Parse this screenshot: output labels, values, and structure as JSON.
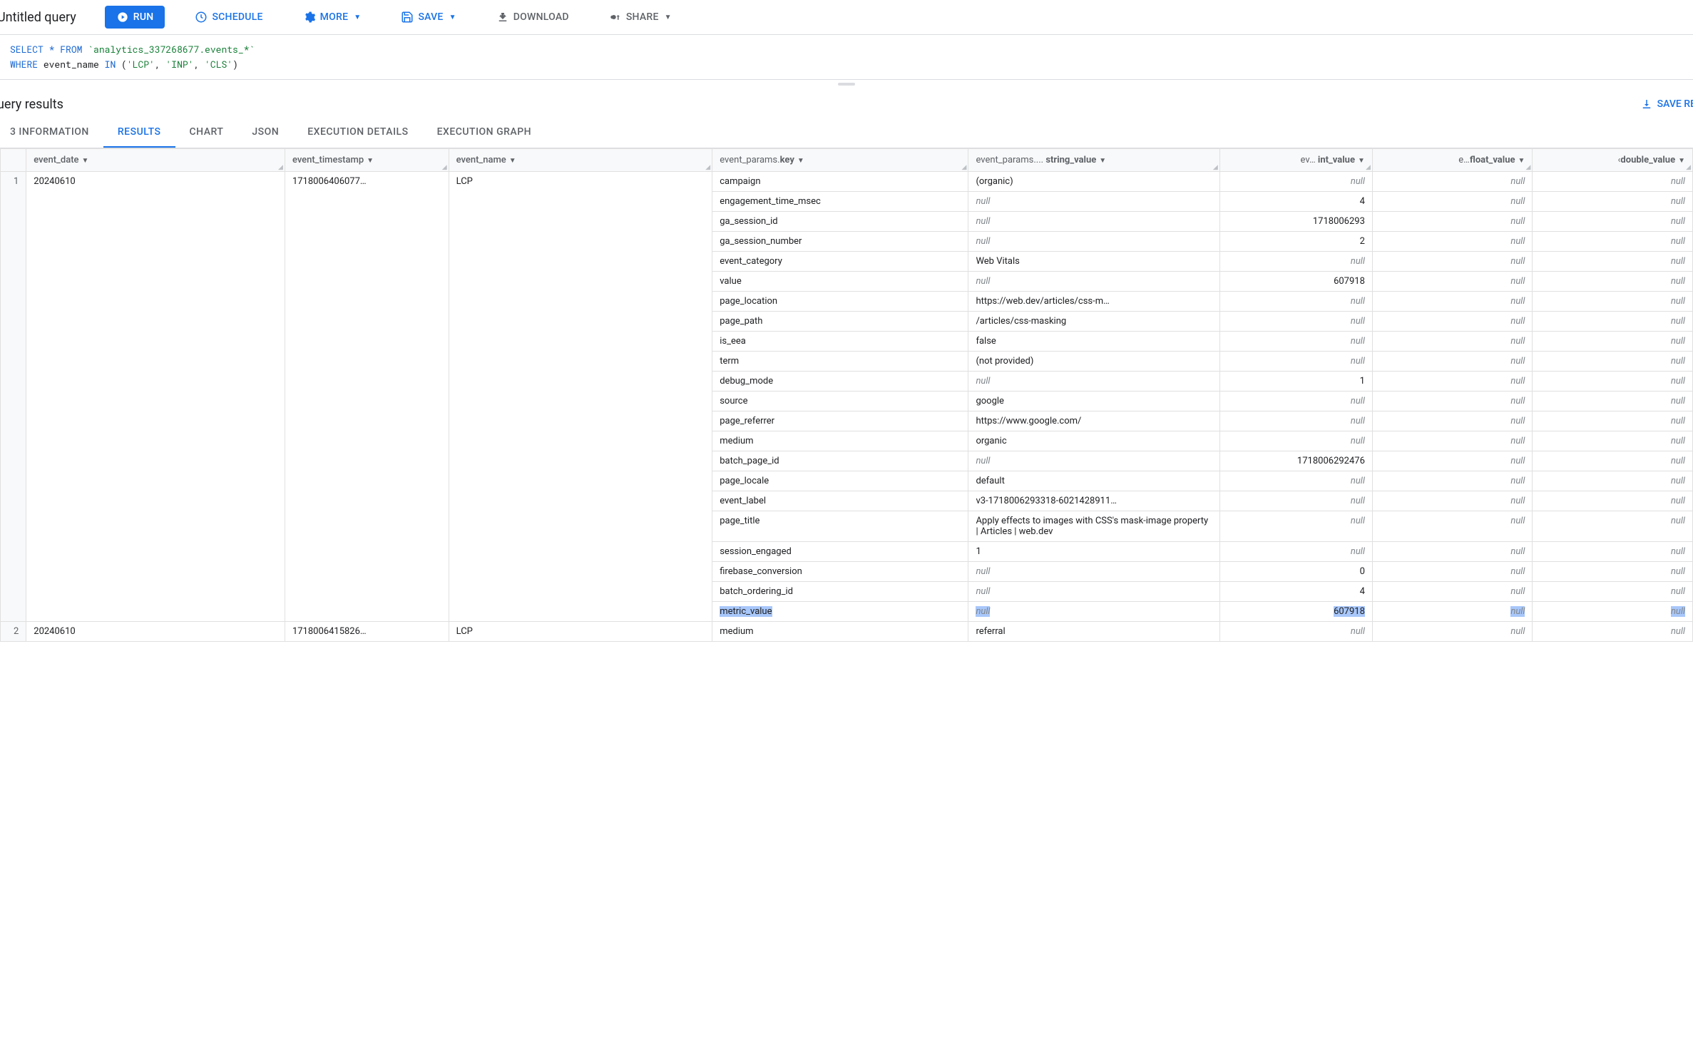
{
  "header": {
    "title": "Untitled query",
    "run": "RUN",
    "schedule": "SCHEDULE",
    "more": "MORE",
    "save": "SAVE",
    "download": "DOWNLOAD",
    "share": "SHARE"
  },
  "sql": {
    "line1_pre": "SELECT * FROM ",
    "line1_tbl": "`analytics_337268677.events_*`",
    "line2_pre": "WHERE",
    "line2_mid": " event_name ",
    "line2_in": "IN",
    "line2_p1": " (",
    "line2_s1": "'LCP'",
    "line2_c1": ", ",
    "line2_s2": "'INP'",
    "line2_c2": ", ",
    "line2_s3": "'CLS'",
    "line2_p2": ")"
  },
  "results": {
    "title": "uery results",
    "save_results": "SAVE RE"
  },
  "tabs": [
    "3 INFORMATION",
    "RESULTS",
    "CHART",
    "JSON",
    "EXECUTION DETAILS",
    "EXECUTION GRAPH"
  ],
  "active_tab": 1,
  "columns": {
    "row": "",
    "event_date": "event_date",
    "event_timestamp": "event_timestamp",
    "event_name": "event_name",
    "event_params_key": "event_params.",
    "event_params_key_bold": "key",
    "event_params_string": "event_params.",
    "event_params_string_pre": "...",
    "event_params_string_bold": "string_value",
    "int_col_pre": "ev…",
    "int_col": "int_value",
    "float_col_pre": "e…",
    "float_col": "float_value",
    "double_col_pre": "‹",
    "double_col": "double_value"
  },
  "rows": [
    {
      "num": "1",
      "event_date": "20240610",
      "event_timestamp": "1718006406077…",
      "event_name": "LCP",
      "params": [
        {
          "key": "campaign",
          "string_value": "(organic)",
          "int_value": null,
          "float_value": null,
          "double_value": null
        },
        {
          "key": "engagement_time_msec",
          "string_value": null,
          "int_value": "4",
          "float_value": null,
          "double_value": null
        },
        {
          "key": "ga_session_id",
          "string_value": null,
          "int_value": "1718006293",
          "float_value": null,
          "double_value": null
        },
        {
          "key": "ga_session_number",
          "string_value": null,
          "int_value": "2",
          "float_value": null,
          "double_value": null
        },
        {
          "key": "event_category",
          "string_value": "Web Vitals",
          "int_value": null,
          "float_value": null,
          "double_value": null
        },
        {
          "key": "value",
          "string_value": null,
          "int_value": "607918",
          "float_value": null,
          "double_value": null
        },
        {
          "key": "page_location",
          "string_value": "https://web.dev/articles/css-m…",
          "int_value": null,
          "float_value": null,
          "double_value": null
        },
        {
          "key": "page_path",
          "string_value": "/articles/css-masking",
          "int_value": null,
          "float_value": null,
          "double_value": null
        },
        {
          "key": "is_eea",
          "string_value": "false",
          "int_value": null,
          "float_value": null,
          "double_value": null
        },
        {
          "key": "term",
          "string_value": "(not provided)",
          "int_value": null,
          "float_value": null,
          "double_value": null
        },
        {
          "key": "debug_mode",
          "string_value": null,
          "int_value": "1",
          "float_value": null,
          "double_value": null
        },
        {
          "key": "source",
          "string_value": "google",
          "int_value": null,
          "float_value": null,
          "double_value": null
        },
        {
          "key": "page_referrer",
          "string_value": "https://www.google.com/",
          "int_value": null,
          "float_value": null,
          "double_value": null
        },
        {
          "key": "medium",
          "string_value": "organic",
          "int_value": null,
          "float_value": null,
          "double_value": null
        },
        {
          "key": "batch_page_id",
          "string_value": null,
          "int_value": "1718006292476",
          "float_value": null,
          "double_value": null
        },
        {
          "key": "page_locale",
          "string_value": "default",
          "int_value": null,
          "float_value": null,
          "double_value": null
        },
        {
          "key": "event_label",
          "string_value": "v3-1718006293318-6021428911…",
          "int_value": null,
          "float_value": null,
          "double_value": null
        },
        {
          "key": "page_title",
          "string_value": "Apply effects to images with CSS's mask-image property  |  Articles  |  web.dev",
          "int_value": null,
          "float_value": null,
          "double_value": null,
          "wrap": true
        },
        {
          "key": "session_engaged",
          "string_value": "1",
          "int_value": null,
          "float_value": null,
          "double_value": null
        },
        {
          "key": "firebase_conversion",
          "string_value": null,
          "int_value": "0",
          "float_value": null,
          "double_value": null
        },
        {
          "key": "batch_ordering_id",
          "string_value": null,
          "int_value": "4",
          "float_value": null,
          "double_value": null
        },
        {
          "key": "metric_value",
          "string_value": null,
          "int_value": "607918",
          "float_value": null,
          "double_value": null,
          "highlight": true
        }
      ]
    },
    {
      "num": "2",
      "event_date": "20240610",
      "event_timestamp": "1718006415826…",
      "event_name": "LCP",
      "params": [
        {
          "key": "medium",
          "string_value": "referral",
          "int_value": null,
          "float_value": null,
          "double_value": null
        }
      ]
    }
  ],
  "null_text": "null"
}
